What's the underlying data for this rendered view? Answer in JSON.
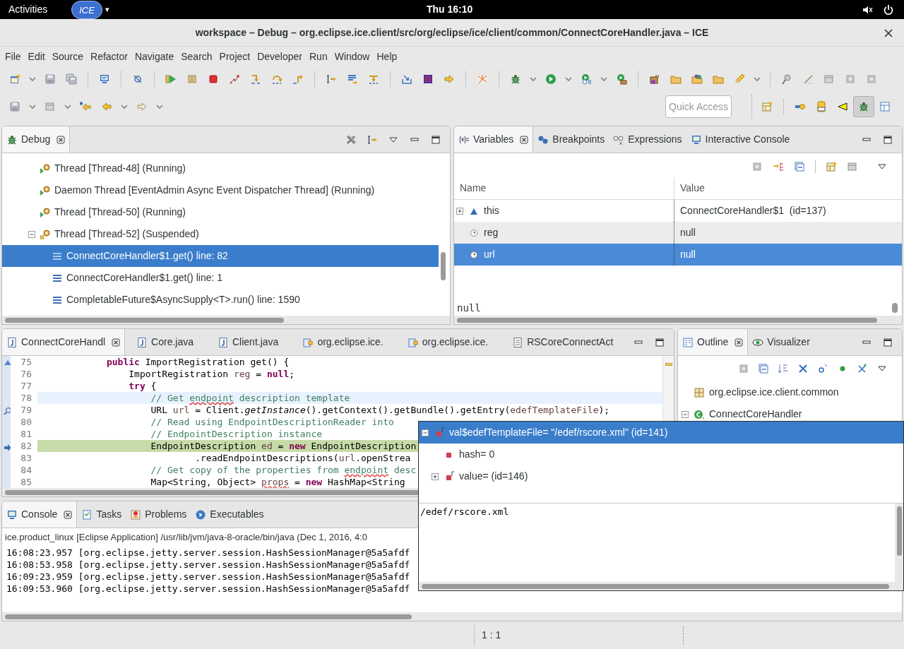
{
  "topbar": {
    "activities": "Activities",
    "app": "ICE",
    "app_caret": "▾",
    "clock": "Thu 16:10"
  },
  "window": {
    "title": "workspace – Debug – org.eclipse.ice.client/src/org/eclipse/ice/client/common/ConnectCoreHandler.java – ICE"
  },
  "menu": [
    "File",
    "Edit",
    "Source",
    "Refactor",
    "Navigate",
    "Search",
    "Project",
    "Developer",
    "Run",
    "Window",
    "Help"
  ],
  "quick_access": {
    "placeholder": "Quick Access"
  },
  "debug_view": {
    "tabs": [
      {
        "label": "Debug",
        "selected": true
      }
    ],
    "threads": [
      {
        "label": "Thread [Thread-48] (Running)",
        "kind": "running",
        "expanded": false,
        "selected": false
      },
      {
        "label": "Daemon Thread [EventAdmin Async Event Dispatcher Thread] (Running)",
        "kind": "running",
        "expanded": false,
        "selected": false
      },
      {
        "label": "Thread [Thread-50] (Running)",
        "kind": "running",
        "expanded": false,
        "selected": false
      },
      {
        "label": "Thread [Thread-52] (Suspended)",
        "kind": "suspended",
        "expanded": true,
        "selected": false,
        "children": [
          {
            "label": "ConnectCoreHandler$1.get() line: 82",
            "kind": "frame",
            "selected": true
          },
          {
            "label": "ConnectCoreHandler$1.get() line: 1",
            "kind": "frame",
            "selected": false
          },
          {
            "label": "CompletableFuture$AsyncSupply<T>.run() line: 1590",
            "kind": "frame",
            "selected": false
          }
        ]
      }
    ]
  },
  "variables_view": {
    "tabs": [
      {
        "label": "Variables",
        "kind": "variables",
        "selected": true
      },
      {
        "label": "Breakpoints",
        "kind": "breakpoints",
        "selected": false
      },
      {
        "label": "Expressions",
        "kind": "expressions",
        "selected": false
      },
      {
        "label": "Interactive Console",
        "kind": "console",
        "selected": false
      }
    ],
    "columns": [
      "Name",
      "Value"
    ],
    "rows": [
      {
        "name": "this",
        "value": "ConnectCoreHandler$1  (id=137)",
        "kind": "object",
        "expanded": false,
        "selected": false
      },
      {
        "name": "reg",
        "value": "null",
        "kind": "local",
        "selected": false
      },
      {
        "name": "url",
        "value": "null",
        "kind": "local",
        "selected": true
      }
    ],
    "detail": "null"
  },
  "editor": {
    "tabs": [
      {
        "label": "ConnectCoreHandl",
        "kind": "java",
        "selected": true
      },
      {
        "label": "Core.java",
        "kind": "java",
        "selected": false
      },
      {
        "label": "Client.java",
        "kind": "java",
        "selected": false
      },
      {
        "label": "org.eclipse.ice.",
        "kind": "plugin",
        "selected": false
      },
      {
        "label": "org.eclipse.ice.",
        "kind": "plugin",
        "selected": false
      },
      {
        "label": "RSCoreConnectAct",
        "kind": "text",
        "selected": false
      }
    ],
    "lines": [
      {
        "number": "75",
        "override": true,
        "tokens": [
          {
            "kind": "keyword",
            "text": "            public"
          },
          {
            "kind": "plain",
            "text": " ImportRegistration get() {"
          }
        ]
      },
      {
        "number": "76",
        "tokens": [
          {
            "kind": "plain",
            "text": "                ImportRegistration "
          },
          {
            "kind": "local",
            "text": "reg"
          },
          {
            "kind": "plain",
            "text": " = "
          },
          {
            "kind": "keyword",
            "text": "null"
          },
          {
            "kind": "plain",
            "text": ";"
          }
        ]
      },
      {
        "number": "77",
        "tokens": [
          {
            "kind": "keyword",
            "text": "                try"
          },
          {
            "kind": "plain",
            "text": " {"
          }
        ]
      },
      {
        "number": "78",
        "current_line": true,
        "tokens": [
          {
            "kind": "comment",
            "text": "                    // Get "
          },
          {
            "kind": "typo",
            "text": "endpoint"
          },
          {
            "kind": "comment",
            "text": " description template"
          }
        ]
      },
      {
        "number": "79",
        "watchpoint": true,
        "tokens": [
          {
            "kind": "plain",
            "text": "                    URL "
          },
          {
            "kind": "local",
            "text": "url"
          },
          {
            "kind": "plain",
            "text": " = Client."
          },
          {
            "kind": "static",
            "text": "getInstance"
          },
          {
            "kind": "plain",
            "text": "().getContext().getBundle().getEntry("
          },
          {
            "kind": "local",
            "text": "edefTemplateFile"
          },
          {
            "kind": "plain",
            "text": ");"
          }
        ]
      },
      {
        "number": "80",
        "tokens": [
          {
            "kind": "comment",
            "text": "                    // Read using EndpointDescriptionReader into"
          }
        ]
      },
      {
        "number": "81",
        "tokens": [
          {
            "kind": "comment",
            "text": "                    // EndpointDescription instance"
          }
        ]
      },
      {
        "number": "82",
        "execution_point": true,
        "tokens": [
          {
            "kind": "plain",
            "text": "                    EndpointDescription "
          },
          {
            "kind": "local",
            "text": "ed"
          },
          {
            "kind": "plain",
            "text": " = "
          },
          {
            "kind": "keyword",
            "text": "new"
          },
          {
            "kind": "plain",
            "text": " EndpointDescription"
          }
        ]
      },
      {
        "number": "83",
        "tokens": [
          {
            "kind": "plain",
            "text": "                            .readEndpointDescriptions("
          },
          {
            "kind": "local",
            "text": "url"
          },
          {
            "kind": "plain",
            "text": ".openStrea"
          }
        ]
      },
      {
        "number": "84",
        "tokens": [
          {
            "kind": "comment",
            "text": "                    // Get copy of the properties from "
          },
          {
            "kind": "typo",
            "text": "endpoint"
          },
          {
            "kind": "comment",
            "text": " desc"
          }
        ]
      },
      {
        "number": "85",
        "tokens": [
          {
            "kind": "plain",
            "text": "                    Map<String, Object> "
          },
          {
            "kind": "localtypo",
            "text": "props"
          },
          {
            "kind": "plain",
            "text": " = "
          },
          {
            "kind": "keyword",
            "text": "new"
          },
          {
            "kind": "plain",
            "text": " HashMap<String"
          }
        ]
      }
    ]
  },
  "outline_view": {
    "tabs": [
      {
        "label": "Outline",
        "kind": "outline",
        "selected": true
      },
      {
        "label": "Visualizer",
        "kind": "visualizer",
        "selected": false
      }
    ],
    "items": [
      {
        "label": "org.eclipse.ice.client.common",
        "kind": "package"
      },
      {
        "label": "ConnectCoreHandler",
        "kind": "class",
        "expanded": true
      }
    ]
  },
  "console_view": {
    "tabs": [
      {
        "label": "Console",
        "kind": "console",
        "selected": true
      },
      {
        "label": "Tasks",
        "kind": "tasks",
        "selected": false
      },
      {
        "label": "Problems",
        "kind": "problems",
        "selected": false
      },
      {
        "label": "Executables",
        "kind": "executables",
        "selected": false
      }
    ],
    "process": "ice.product_linux [Eclipse Application] /usr/lib/jvm/java-8-oracle/bin/java (Dec 1, 2016, 4:0",
    "lines": [
      "16:08:23.957 [org.eclipse.jetty.server.session.HashSessionManager@5a5afdf",
      "16:08:53.958 [org.eclipse.jetty.server.session.HashSessionManager@5a5afdf",
      "16:09:23.959 [org.eclipse.jetty.server.session.HashSessionManager@5a5afdf",
      "16:09:53.960 [org.eclipse.jetty.server.session.HashSessionManager@5a5afdf"
    ]
  },
  "hover_popup": {
    "rows": [
      {
        "label": "val$edefTemplateFile= \"/edef/rscore.xml\" (id=141)",
        "kind": "object",
        "expanded": true,
        "selected": true,
        "children": [
          {
            "label": "hash= 0",
            "kind": "primitive",
            "selected": false
          },
          {
            "label": "value= (id=146)",
            "kind": "object",
            "expanded": false,
            "selected": false
          }
        ]
      }
    ],
    "detail": "/edef/rscore.xml"
  },
  "status_bar": {
    "position": "1 : 1"
  }
}
